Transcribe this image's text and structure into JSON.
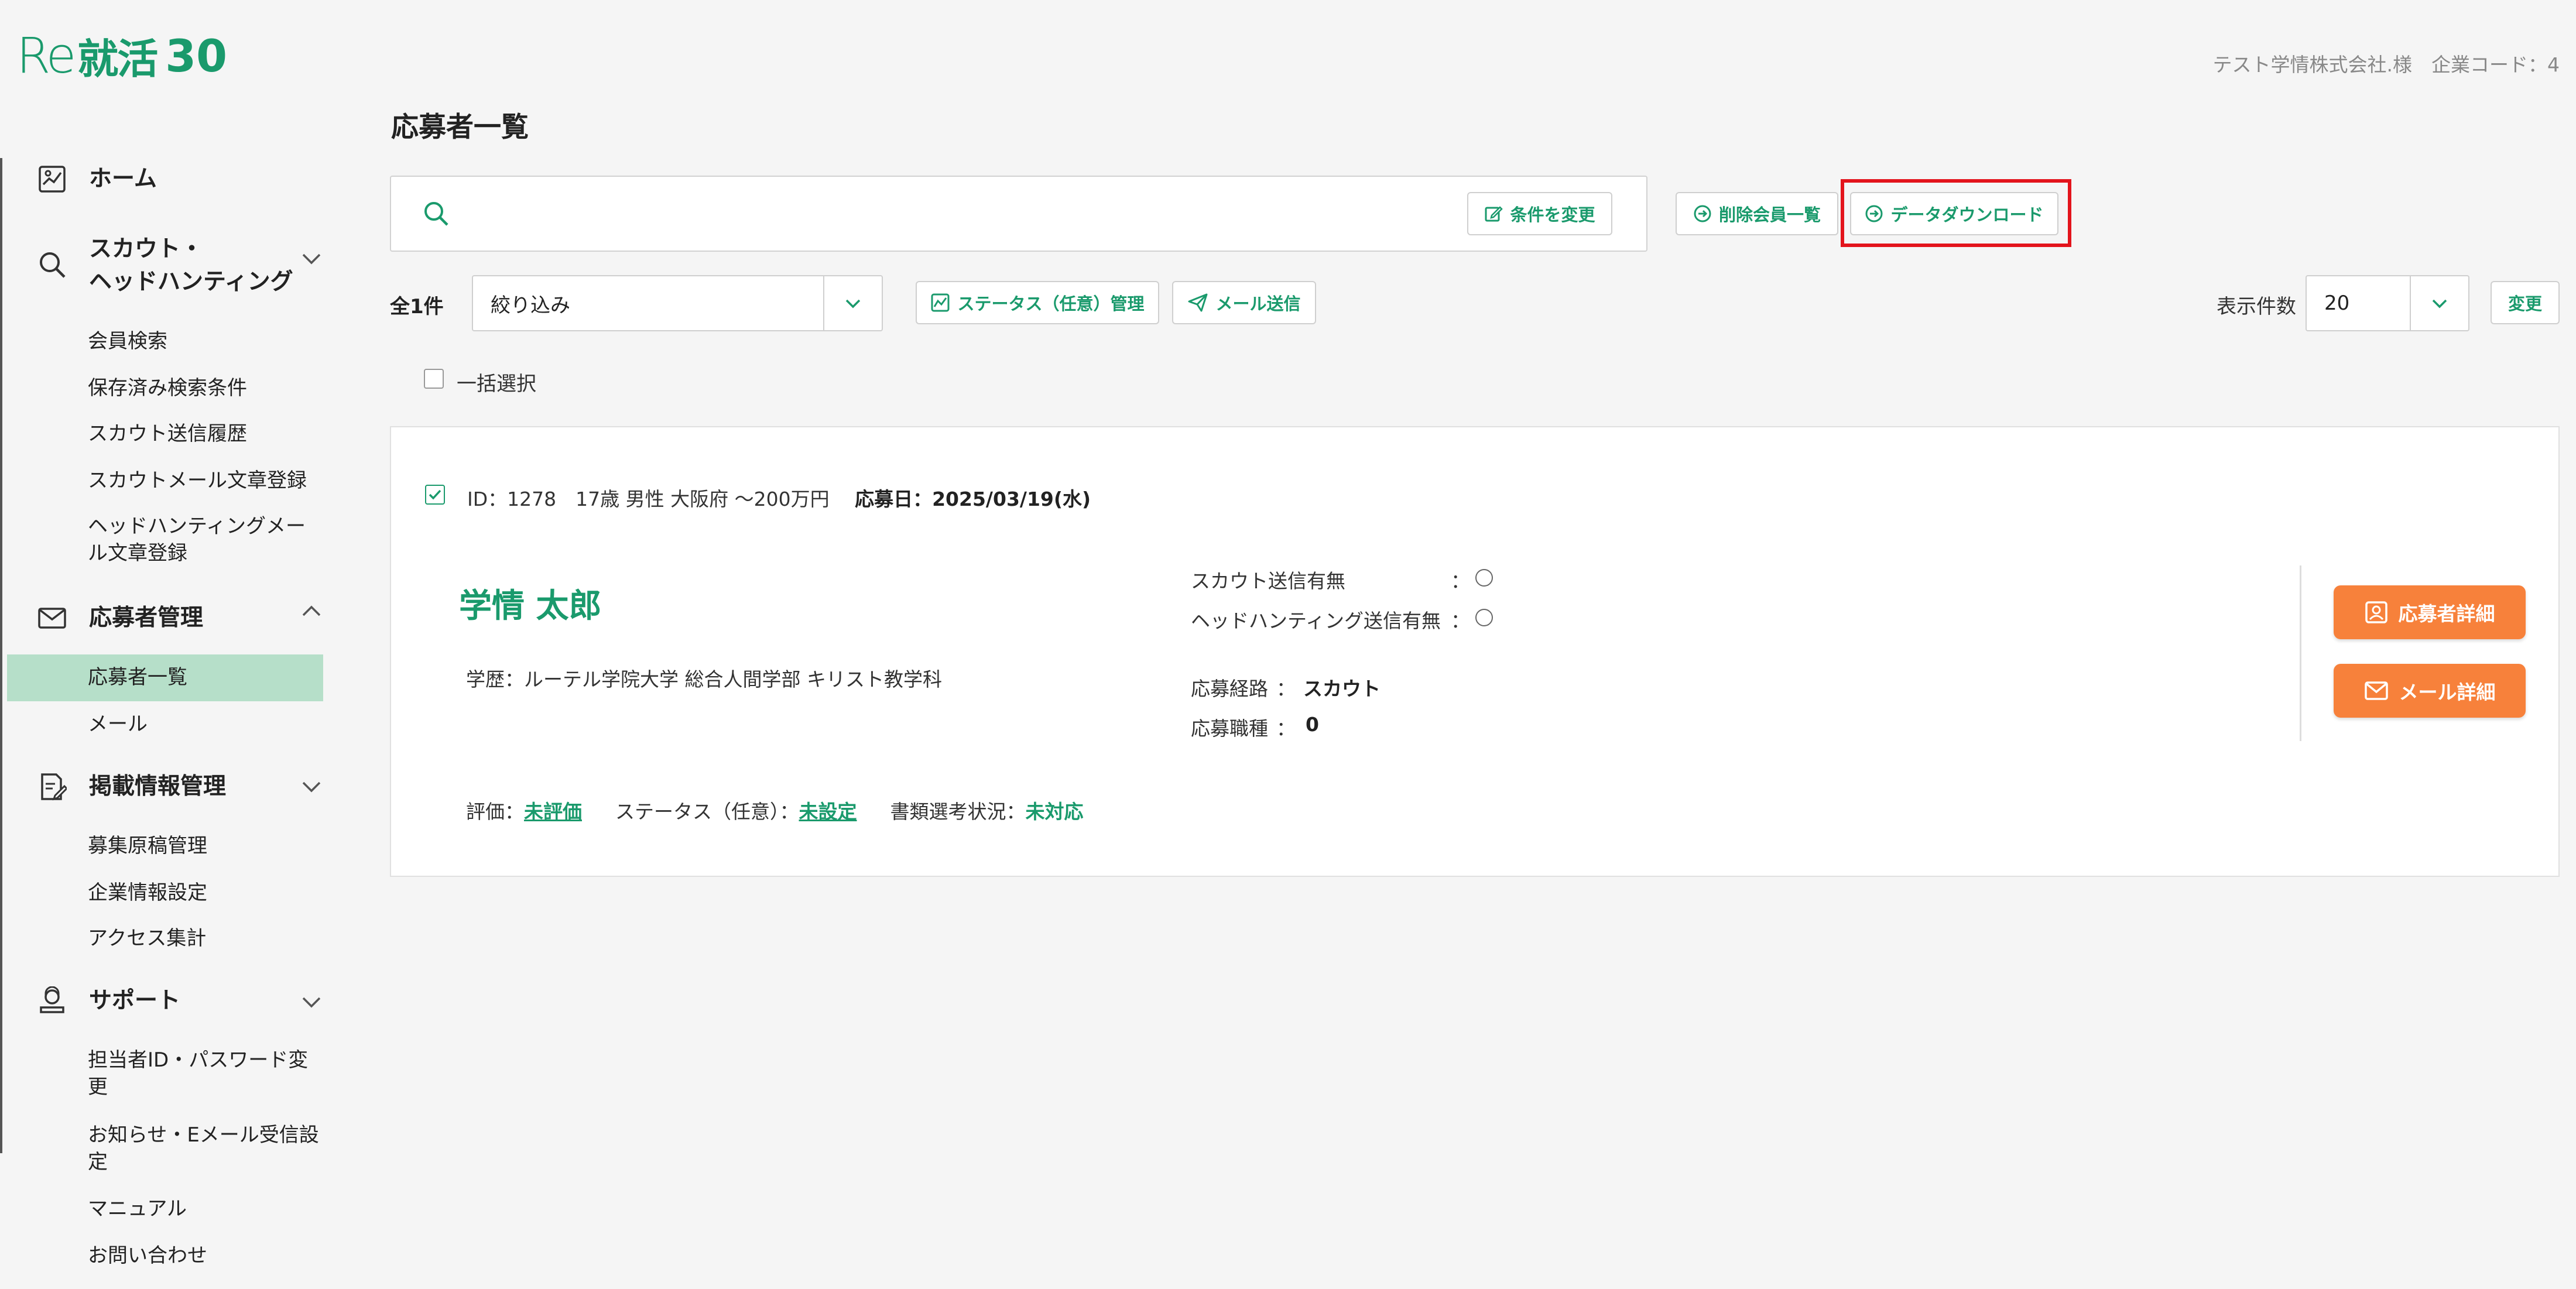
{
  "header": {
    "logo_re": "Re",
    "logo_text": "就活",
    "logo_number": "30",
    "company_info": "テスト学情株式会社.様　企業コード：4"
  },
  "sidebar": {
    "home": "ホーム",
    "scout": "スカウト・\nヘッドハンティング",
    "scout_items": [
      "会員検索",
      "保存済み検索条件",
      "スカウト送信履歴",
      "スカウトメール文章登録",
      "ヘッドハンティングメー\nル文章登録"
    ],
    "applicants": "応募者管理",
    "applicants_items": [
      "応募者一覧",
      "メール"
    ],
    "postings": "掲載情報管理",
    "postings_items": [
      "募集原稿管理",
      "企業情報設定",
      "アクセス集計"
    ],
    "support": "サポート",
    "support_items": [
      "担当者ID・パスワード変\n更",
      "お知らせ・Eメール受信設\n定",
      "マニュアル",
      "お問い合わせ"
    ]
  },
  "main": {
    "title": "応募者一覧",
    "change_conditions": "条件を変更",
    "deleted_members": "削除会員一覧",
    "data_download": "データダウンロード",
    "total_count": "全1件",
    "filter_value": "絞り込み",
    "status_manage": "ステータス（任意）管理",
    "send_mail": "メール送信",
    "per_page_label": "表示件数",
    "per_page_value": "20",
    "change_button": "変更",
    "select_all": "一括選択"
  },
  "applicant": {
    "id_text": "ID：1278　17歳 男性 大阪府 ～200万円",
    "applied_date": "応募日：2025/03/19(水)",
    "name": "学情 太郎",
    "education": "学歴：ルーテル学院大学 総合人間学部 キリスト教学科",
    "scout_sent_label": "スカウト送信有無",
    "headhunt_sent_label": "ヘッドハンティング送信有無",
    "colon": "：",
    "route_label": "応募経路",
    "route_value": "スカウト",
    "job_type_label": "応募職種",
    "job_type_value": "0",
    "rating_label": "評価：",
    "rating_value": "未評価",
    "status_label": "ステータス（任意）：",
    "status_value": "未設定",
    "doc_label": "書類選考状況：",
    "doc_value": "未対応",
    "detail_button": "応募者詳細",
    "mail_detail_button": "メール詳細"
  },
  "colors": {
    "accent": "#1a9a6c",
    "orange": "#f7813b",
    "highlight": "#e3141c",
    "active_nav": "#b6dfc9"
  }
}
